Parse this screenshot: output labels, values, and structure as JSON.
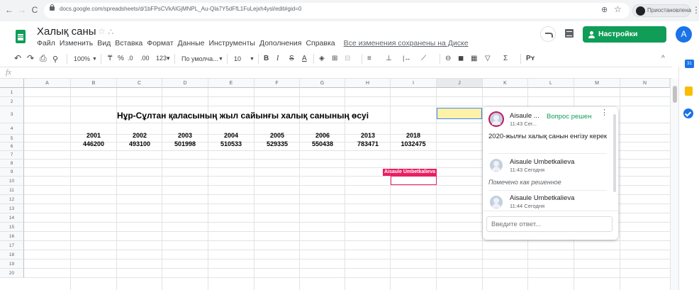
{
  "browser": {
    "back": "←",
    "forward": "→",
    "reload": "C",
    "url": "docs.google.com/spreadsheets/d/1bFPsCVkAlGjMNPL_Au-Qla7Y5dFfL1FuLejxh4ysl/edit#gid=0",
    "zoom_icon": "⊕",
    "star_icon": "☆",
    "profile_label": "Приостановлена",
    "menu_icon": "⋮"
  },
  "doc": {
    "title": "Халық саны",
    "title_icons": "☆ ⛬",
    "menu": [
      "Файл",
      "Изменить",
      "Вид",
      "Вставка",
      "Формат",
      "Данные",
      "Инструменты",
      "Дополнения",
      "Справка"
    ],
    "saved_status": "Все изменения сохранены на Диске",
    "share_label": "Настройки Доступа",
    "user_initial": "A"
  },
  "toolbar": {
    "undo": "↶",
    "redo": "↷",
    "print": "⎙",
    "paint_format": "⚲",
    "zoom": "100%",
    "currency": "₸",
    "percent": "%",
    "dec_less": ".0",
    "dec_more": ".00",
    "format_more": "123▾",
    "font": "По умолча...",
    "font_size": "10",
    "bold": "B",
    "italic": "I",
    "strike": "S",
    "text_color": "A",
    "fill": "◈",
    "borders": "⊞",
    "merge": "⊟",
    "halign": "≡",
    "valign": "⊥",
    "wrap": "|↔",
    "rotate": "⟋",
    "link": "⊖",
    "comment": "◼",
    "chart": "▦",
    "filter": "▽",
    "functions": "Σ",
    "input_tools": "Pʏ",
    "collapse": "^"
  },
  "formula_bar": {
    "label": "fx",
    "value": ""
  },
  "sheet": {
    "columns": [
      "A",
      "B",
      "C",
      "D",
      "E",
      "F",
      "G",
      "H",
      "I",
      "J",
      "K",
      "L",
      "M",
      "N"
    ],
    "rows": [
      "1",
      "2",
      "3",
      "4",
      "5",
      "6",
      "7",
      "8",
      "9",
      "10",
      "11",
      "12",
      "13",
      "14",
      "15",
      "16",
      "17",
      "18",
      "19",
      "20"
    ],
    "title": "Нұр-Сұлтан қаласының жыл сайынғы халық санының өсуі",
    "years": [
      "2001",
      "2002",
      "2003",
      "2004",
      "2005",
      "2006",
      "2013",
      "2018"
    ],
    "populations": [
      "446200",
      "493100",
      "501998",
      "510533",
      "529335",
      "550438",
      "783471",
      "1032475"
    ],
    "collaborator_tag": "Aisaule Umbetkalieva"
  },
  "comments": {
    "first_author": "Aisaule ...",
    "first_time": "11:43 Сег...",
    "resolve_label": "Вопрос решен",
    "kebab": "⋮",
    "first_text": "2020-жылғы халық санын енгізу керек",
    "second_author": "Aisaule Umbetkalieva",
    "second_time": "11:43 Сегодня",
    "second_text": "Помечено как решенное",
    "third_author": "Aisaule Umbetkalieva",
    "third_time": "11:44 Сегодня",
    "reply_placeholder": "Введите ответ..."
  },
  "side_panel": {
    "calendar": "31"
  },
  "colors": {
    "accent": "#0f9d58",
    "selection": "#fef2a8",
    "collaborator": "#e91e63"
  }
}
